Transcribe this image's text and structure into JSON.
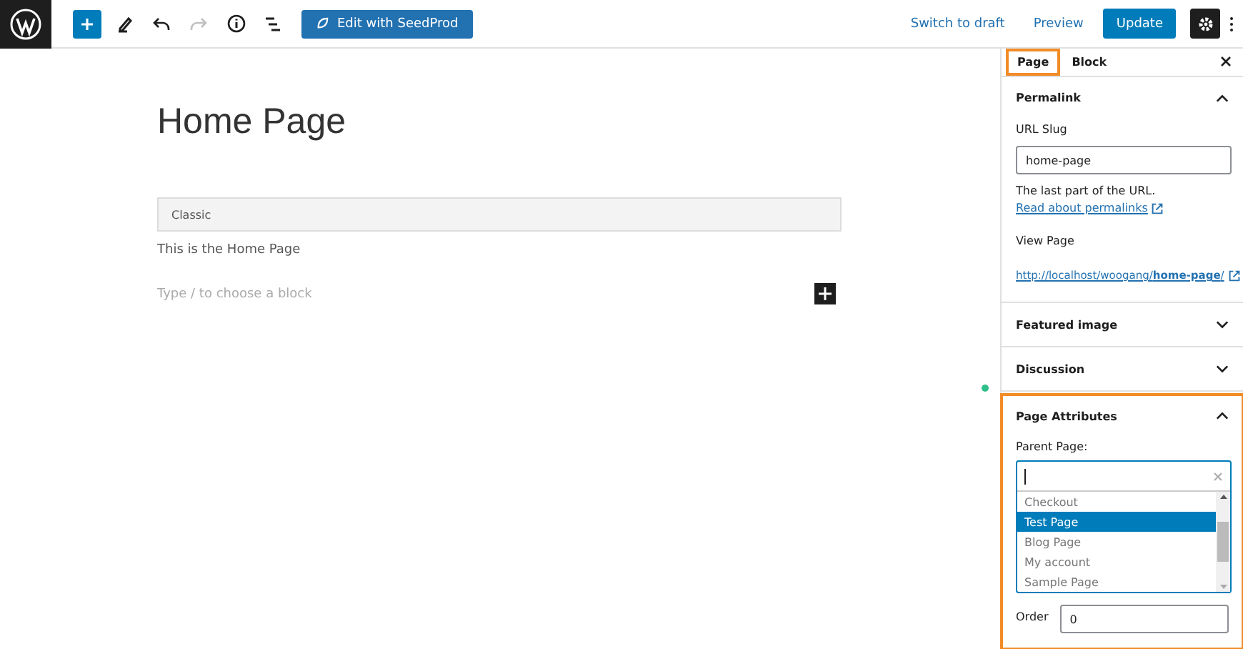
{
  "toolbar": {
    "seedprod_button": "Edit with SeedProd",
    "redo_disabled": true,
    "switch_to_draft": "Switch to draft",
    "preview": "Preview",
    "update": "Update",
    "settings_on": true
  },
  "editor": {
    "title": "Home Page",
    "classic_label": "Classic",
    "paragraph": "This is the Home Page",
    "block_placeholder": "Type / to choose a block"
  },
  "sidebar": {
    "tabs": [
      {
        "label": "Page",
        "selected": true,
        "highlighted": true
      },
      {
        "label": "Block",
        "selected": false,
        "highlighted": false
      }
    ],
    "permalink": {
      "title": "Permalink",
      "expanded": true,
      "slug_label": "URL Slug",
      "slug": "home-page",
      "help": "The last part of the URL.",
      "help_link": "Read about permalinks",
      "view_label": "View Page",
      "url": "http://localhost/woogang/**home-page**/"
    },
    "panels": [
      {
        "title": "Featured image",
        "expanded": false
      },
      {
        "title": "Discussion",
        "expanded": false
      }
    ],
    "attributes": {
      "title": "Page Attributes",
      "expanded": true,
      "highlighted": true,
      "parent_label": "Parent Page:",
      "options": [
        {
          "label": "Checkout",
          "selected": false
        },
        {
          "label": "Test Page",
          "selected": true
        },
        {
          "label": "Blog Page",
          "selected": false
        },
        {
          "label": "My account",
          "selected": false
        },
        {
          "label": "Sample Page",
          "selected": false
        }
      ],
      "order_label": "Order",
      "order": "0"
    }
  }
}
